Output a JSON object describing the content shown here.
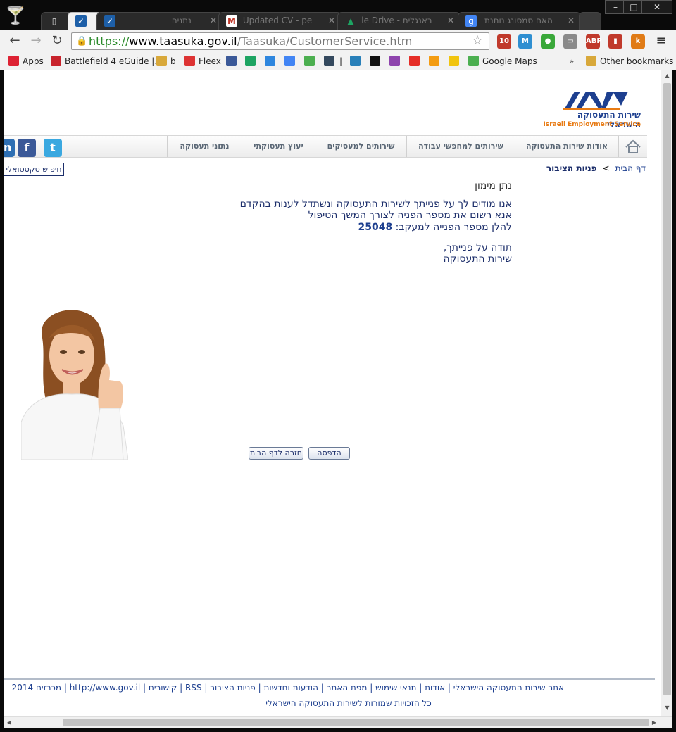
{
  "browser": {
    "tabs": [
      {
        "label": "",
        "icon": "page-icon"
      },
      {
        "label": "",
        "icon": "checkmark-icon",
        "active": true
      },
      {
        "label": "נתניה",
        "icon": "checkmark-icon"
      },
      {
        "label": "Updated CV - peryum",
        "icon": "gmail-icon"
      },
      {
        "label": "באנגלית - Google Drive",
        "icon": "drive-icon"
      },
      {
        "label": "האם סמסונג נותנת או",
        "icon": "google-icon"
      }
    ],
    "url": {
      "protocol": "https://",
      "host": "www.taasuka.gov.il",
      "path": "/Taasuka/CustomerService.htm"
    },
    "extensions": [
      {
        "name": "gmail-ext",
        "label": "10",
        "color": "#c0392b"
      },
      {
        "name": "m-ext",
        "label": "M",
        "color": "#2f8fd1"
      },
      {
        "name": "evernote-ext",
        "label": "●",
        "color": "#3aa83a"
      },
      {
        "name": "cast-ext",
        "label": "▭",
        "color": "#8a8a8a"
      },
      {
        "name": "adblock-ext",
        "label": "ABP",
        "color": "#c0392b"
      },
      {
        "name": "book-ext",
        "label": "▮",
        "color": "#c0392b"
      },
      {
        "name": "k-ext",
        "label": "k",
        "color": "#e07b16"
      }
    ],
    "bookmarks": [
      {
        "label": "Apps",
        "icon": "apps-icon",
        "color": "#d23"
      },
      {
        "label": "Battlefield 4 eGuide |...",
        "icon": "pinterest-icon",
        "color": "#c8232c"
      },
      {
        "label": "b",
        "icon": "folder-icon",
        "color": "#d8a83a"
      },
      {
        "label": "Fleex",
        "icon": "popcorn-icon",
        "color": "#d33"
      },
      {
        "label": "",
        "icon": "facebook-icon",
        "color": "#3b5998"
      },
      {
        "label": "",
        "icon": "drive-icon",
        "color": "#1da462"
      },
      {
        "label": "",
        "icon": "nine-icon",
        "color": "#2e86de"
      },
      {
        "label": "",
        "icon": "translate-icon",
        "color": "#4285f4"
      },
      {
        "label": "",
        "icon": "maps-icon",
        "color": "#4caf50"
      },
      {
        "label": "",
        "icon": "j-icon",
        "color": "#34495e"
      },
      {
        "label": "|",
        "icon": "",
        "color": ""
      },
      {
        "label": "",
        "icon": "feed-icon",
        "color": "#2980b9"
      },
      {
        "label": "",
        "icon": "i-icon",
        "color": "#111"
      },
      {
        "label": "",
        "icon": "flower-icon",
        "color": "#8e44ad"
      },
      {
        "label": "",
        "icon": "youtube-icon",
        "color": "#e52d27"
      },
      {
        "label": "",
        "icon": "circle-icon",
        "color": "#f39c12"
      },
      {
        "label": "",
        "icon": "play-icon",
        "color": "#f1c40f"
      },
      {
        "label": "Google Maps",
        "icon": "maps-icon",
        "color": "#4caf50"
      }
    ],
    "other_bookmarks": "Other bookmarks",
    "more": "»"
  },
  "site": {
    "logo": {
      "he": "שירות התעסוקה הישראלי",
      "en": "Israeli Employment Service"
    },
    "nav": [
      "אודות שירות התעסוקה",
      "שירותים למחפשי עבודה",
      "שירותים למעסיקים",
      "יעוץ תעסוקתי",
      "נתוני תעסוקה"
    ],
    "text_search": "חיפוש טקסטואלי",
    "breadcrumb": {
      "home": "דף הבית",
      "sep": ">",
      "current": "פניות הציבור"
    },
    "message": {
      "greeting": "נתן מימון",
      "line1": "אנו מודים לך על פנייתך לשירות התעסוקה ונשתדל לענות בהקדם",
      "line2": "אנא רשום את מספר הפניה לצורך המשך הטיפול",
      "line3_prefix": "להלן מספר הפנייה למעקב:",
      "ticket": "25048",
      "thanks": "תודה על פנייתך,",
      "signature": "שירות התעסוקה"
    },
    "buttons": {
      "print": "הדפסה",
      "home": "חזרה לדף הבית"
    },
    "footer": {
      "links": "אתר שירות התעסוקה הישראלי | אודות | תנאי שימוש | מפת האתר | הודעות וחדשות | פניות הציבור | RSS | קישורים | http://www.gov.il | מכרזים 2014",
      "copyright": "כל הזכויות שמורות לשירות התעסוקה הישראלי"
    }
  }
}
